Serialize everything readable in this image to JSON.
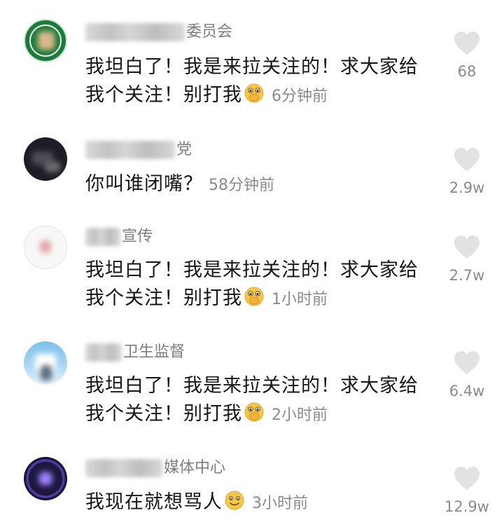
{
  "comments": [
    {
      "name_suffix": "委员会",
      "text_line1": "我坦白了！我是来拉关注的！求大家给",
      "text_line2": "我个关注！别打我",
      "emoji": "pleading-hands-face",
      "time": "6分钟前",
      "likes": "68"
    },
    {
      "name_suffix": "党",
      "text_line1": "你叫谁闭嘴？",
      "text_line2": "",
      "emoji": "",
      "time": "58分钟前",
      "likes": "2.9w"
    },
    {
      "name_suffix": "宣传",
      "text_line1": "我坦白了！我是来拉关注的！求大家给",
      "text_line2": "我个关注！别打我",
      "emoji": "pleading-hands-face",
      "time": "1小时前",
      "likes": "2.7w"
    },
    {
      "name_suffix": "卫生监督",
      "text_line1": "我坦白了！我是来拉关注的！求大家给",
      "text_line2": "我个关注！别打我",
      "emoji": "pleading-hands-face",
      "time": "2小时前",
      "likes": "6.4w"
    },
    {
      "name_suffix": "媒体中心",
      "text_line1": "我现在就想骂人",
      "text_line2": "",
      "emoji": "smiling-face",
      "time": "3小时前",
      "likes": "12.9w"
    }
  ],
  "icons": {
    "like": "heart-icon"
  },
  "colors": {
    "text": "#161616",
    "meta": "#8a8a8a",
    "heart": "#e2e2e2",
    "emoji": "#f6c84a"
  }
}
